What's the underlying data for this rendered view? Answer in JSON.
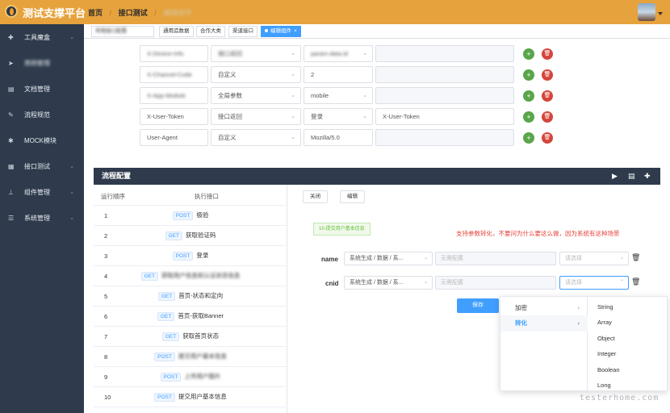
{
  "app": {
    "title": "测试支撑平台"
  },
  "breadcrumb": {
    "home": "首页",
    "sep": "/",
    "section": "接口测试",
    "current": "编辑组件"
  },
  "sidebar": {
    "items": [
      {
        "label": "工具魔盒",
        "icon": "plus-circle-icon",
        "chevron": true,
        "blurred": false
      },
      {
        "label": "用例管理",
        "icon": "send-icon",
        "chevron": false,
        "blurred": true
      },
      {
        "label": "文档管理",
        "icon": "document-icon",
        "chevron": false,
        "blurred": false
      },
      {
        "label": "流程规范",
        "icon": "edit-icon",
        "chevron": false,
        "blurred": false
      },
      {
        "label": "MOCK模块",
        "icon": "bug-icon",
        "chevron": false,
        "blurred": false
      },
      {
        "label": "接口测试",
        "icon": "grid-icon",
        "chevron": true,
        "blurred": false
      },
      {
        "label": "组件管理",
        "icon": "sitemap-icon",
        "chevron": true,
        "blurred": false
      },
      {
        "label": "系统管理",
        "icon": "list-icon",
        "chevron": true,
        "blurred": false
      }
    ]
  },
  "tabs": [
    {
      "label": "常用接口配置",
      "active": false
    },
    {
      "label": "通用造数据",
      "active": false
    },
    {
      "label": "合作大类",
      "active": false
    },
    {
      "label": "渠道接口",
      "active": false
    },
    {
      "label": "编辑组件",
      "active": true
    }
  ],
  "params": {
    "rows": [
      {
        "name": "X-Device-Info",
        "type": "接口返回",
        "value": "param.data.id",
        "extra": ""
      },
      {
        "name": "X-Channel-Code",
        "type": "自定义",
        "value": "2",
        "extra": ""
      },
      {
        "name": "X-App-Module",
        "type": "全局参数",
        "value": "mobile",
        "extra": ""
      },
      {
        "name": "X-User-Token",
        "type": "接口返回",
        "value": "登录",
        "extra": "X-User-Token"
      },
      {
        "name": "User-Agent",
        "type": "自定义",
        "value": "Mozilla/5.0",
        "extra": ""
      }
    ]
  },
  "flow": {
    "title": "流程配置",
    "col_order": "运行顺序",
    "col_api": "执行接口",
    "steps": [
      {
        "n": "1",
        "method": "POST",
        "name": "极验",
        "blurred": false
      },
      {
        "n": "2",
        "method": "GET",
        "name": "获取验证码",
        "blurred": false
      },
      {
        "n": "3",
        "method": "POST",
        "name": "登录",
        "blurred": false
      },
      {
        "n": "4",
        "method": "GET",
        "name": "获取用户信息和认证状态信息",
        "blurred": true
      },
      {
        "n": "5",
        "method": "GET",
        "name": "首页-状态和定向",
        "blurred": false
      },
      {
        "n": "6",
        "method": "GET",
        "name": "首页-获取Banner",
        "blurred": false
      },
      {
        "n": "7",
        "method": "GET",
        "name": "获取首页状态",
        "blurred": false
      },
      {
        "n": "8",
        "method": "POST",
        "name": "提交用户基本信息",
        "blurred": true
      },
      {
        "n": "9",
        "method": "POST",
        "name": "上传用户图片",
        "blurred": true
      },
      {
        "n": "10",
        "method": "POST",
        "name": "提交用户基本信息",
        "blurred": false
      }
    ],
    "close_label": "关闭",
    "edit_label": "编辑",
    "selected_tag": "10-提交用户基本信息",
    "warning": "支持参数转化，不要问为什么要这么做，因为系统有这种场景",
    "fields": [
      {
        "label": "name",
        "source": "系统生成 / 数据 / 系...",
        "config_placeholder": "无需配置",
        "select_placeholder": "请选择"
      },
      {
        "label": "cnid",
        "source": "系统生成 / 数据 / 系...",
        "config_placeholder": "无需配置",
        "select_placeholder": "请选择"
      }
    ],
    "save_label": "保存"
  },
  "cascader": {
    "level1": [
      {
        "label": "加密",
        "active": false
      },
      {
        "label": "转化",
        "active": true
      }
    ],
    "level2": [
      "String",
      "Array",
      "Object",
      "Integer",
      "Boolean",
      "Long"
    ]
  },
  "watermark": "testerhome.com"
}
